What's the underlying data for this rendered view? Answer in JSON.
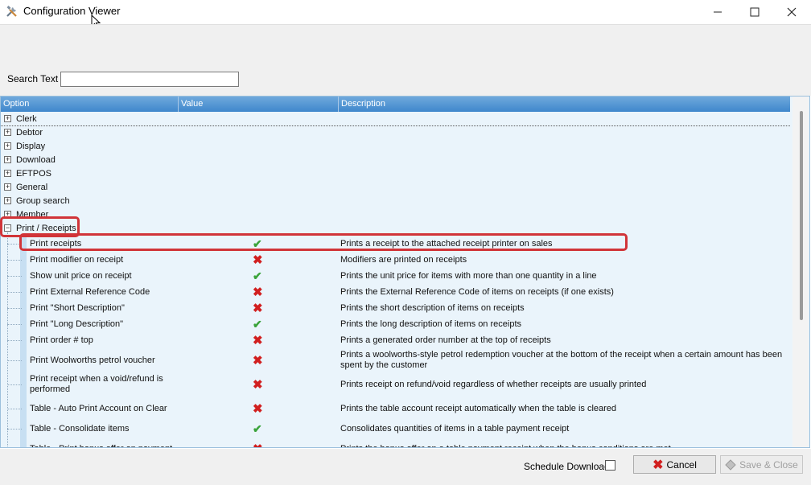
{
  "window": {
    "title": "Configuration Viewer",
    "minimize_glyph": "—",
    "maximize_glyph": "☐",
    "close_glyph": "✕"
  },
  "search": {
    "label": "Search Text",
    "value": "",
    "placeholder": ""
  },
  "grid": {
    "columns": [
      "Option",
      "Value",
      "Description"
    ],
    "groups": [
      {
        "label": "Clerk",
        "expanded": false
      },
      {
        "label": "Debtor",
        "expanded": false
      },
      {
        "label": "Display",
        "expanded": false
      },
      {
        "label": "Download",
        "expanded": false
      },
      {
        "label": "EFTPOS",
        "expanded": false
      },
      {
        "label": "General",
        "expanded": false
      },
      {
        "label": "Group search",
        "expanded": false
      },
      {
        "label": "Member",
        "expanded": false
      },
      {
        "label": "Print / Receipts",
        "expanded": true
      }
    ],
    "print_receipts_rows": [
      {
        "option": "Print receipts",
        "value": true,
        "description": "Prints a receipt to the attached receipt printer on sales"
      },
      {
        "option": "Print modifier on receipt",
        "value": false,
        "description": "Modifiers are printed on receipts"
      },
      {
        "option": "Show unit price on receipt",
        "value": true,
        "description": "Prints the unit price for items with more than one quantity in a line"
      },
      {
        "option": "Print External Reference Code",
        "value": false,
        "description": "Prints the External Reference Code of items on receipts (if one exists)"
      },
      {
        "option": "Print \"Short Description\"",
        "value": false,
        "description": "Prints the short description of items on receipts"
      },
      {
        "option": "Print \"Long Description\"",
        "value": true,
        "description": "Prints the long description of items on receipts"
      },
      {
        "option": "Print order # top",
        "value": false,
        "description": "Prints a generated order number at the top of receipts"
      },
      {
        "option": "Print Woolworths petrol voucher",
        "value": false,
        "description": "Prints a woolworths-style petrol redemption voucher at the bottom of the receipt when a certain amount has been spent by the customer"
      },
      {
        "option": "Print receipt when a void/refund is performed",
        "value": false,
        "description": "Prints receipt on refund/void regardless of whether receipts are usually printed"
      },
      {
        "option": "Table - Auto Print Account on Clear",
        "value": false,
        "description": "Prints the table account receipt automatically when the table is cleared"
      },
      {
        "option": "Table - Consolidate items",
        "value": true,
        "description": "Consolidates quantities of items in a table payment receipt"
      },
      {
        "option": "Table - Print bonus offer on payment",
        "value": false,
        "description": "Prints the bonus offer on a table payment receipt when the bonus conditions are met"
      }
    ]
  },
  "bottom": {
    "schedule_download_label": "Schedule Download",
    "schedule_download_checked": false,
    "cancel_label": "Cancel",
    "save_close_label": "Save & Close"
  },
  "icons": {
    "check": "✔",
    "cross": "✖",
    "plus": "+",
    "minus": "−"
  },
  "colors": {
    "header_blue": "#3f87cc",
    "grid_bg": "#eaf4fb",
    "highlight_red": "#d13438",
    "check_green": "#3aa33a",
    "cross_red": "#d11f1f"
  }
}
